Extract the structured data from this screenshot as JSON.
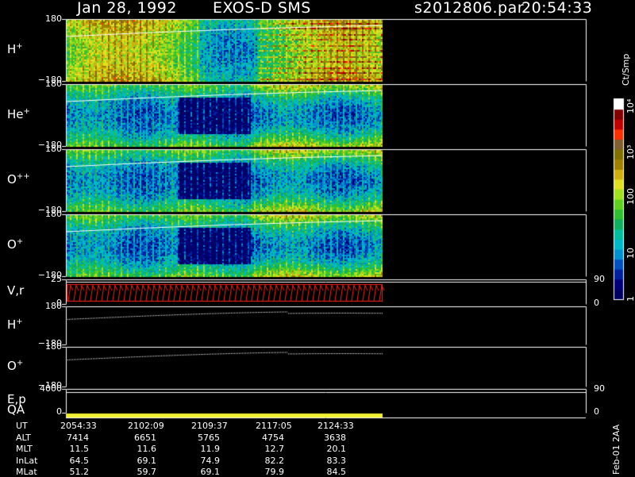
{
  "header": {
    "date": "Jan 28, 1992",
    "mission": "EXOS-D SMS",
    "file": "s2012806.par",
    "time": "20:54:33"
  },
  "chart_data": {
    "type": "heatmap",
    "panels": [
      {
        "label": "H",
        "sup": "+",
        "ymax": "180",
        "ymin": "−180",
        "kind": "spectrogram",
        "palette": "bright"
      },
      {
        "label": "He",
        "sup": "+",
        "ymax": "180",
        "ymin": "−180",
        "kind": "spectrogram",
        "palette": "mid"
      },
      {
        "label": "O",
        "sup": "++",
        "ymax": "180",
        "ymin": "−180",
        "kind": "spectrogram",
        "palette": "mid"
      },
      {
        "label": "O",
        "sup": "+",
        "ymax": "180",
        "ymin": "−180",
        "kind": "spectrogram",
        "palette": "mid"
      },
      {
        "label": "V,r",
        "sup": "",
        "ymax": "25",
        "ymin": "0",
        "right_max": "90",
        "right_min": "0",
        "kind": "vr"
      },
      {
        "label": "H",
        "sup": "+",
        "ymax": "180",
        "ymin": "−180",
        "kind": "line"
      },
      {
        "label": "O",
        "sup": "+",
        "ymax": "180",
        "ymin": "−180",
        "kind": "line"
      },
      {
        "label": "E,p",
        "sup": "",
        "ymax": "4000",
        "ymin": "0",
        "right_max": "90",
        "right_min": "0",
        "kind": "ep"
      }
    ],
    "qa_label": "QA",
    "qa_color": "#f0f030",
    "colorbar": {
      "unit": "Ct/Smp",
      "ticks": [
        "1",
        "10",
        "100",
        "10³",
        "10⁴"
      ],
      "colors": [
        "#000060",
        "#00007a",
        "#0020a0",
        "#0050c0",
        "#0090d0",
        "#00b8c8",
        "#00c0a0",
        "#10b060",
        "#30c030",
        "#60d020",
        "#a0e020",
        "#e0e020",
        "#d0b010",
        "#a08000",
        "#807000",
        "#806030",
        "#ff3000",
        "#c00000",
        "#800000",
        "#ffffff"
      ]
    },
    "footer": {
      "rows": [
        {
          "label": "UT",
          "values": [
            "2054:33",
            "2102:09",
            "2109:37",
            "2117:05",
            "2124:33"
          ]
        },
        {
          "label": "ALT",
          "values": [
            "7414",
            "6651",
            "5765",
            "4754",
            "3638"
          ]
        },
        {
          "label": "MLT",
          "values": [
            "11.5",
            "11.6",
            "11.9",
            "12.7",
            "20.1"
          ]
        },
        {
          "label": "InLat",
          "values": [
            "64.5",
            "69.1",
            "74.9",
            "82.2",
            "83.3"
          ]
        },
        {
          "label": "MLat",
          "values": [
            "51.2",
            "59.7",
            "69.1",
            "79.9",
            "84.5"
          ]
        }
      ]
    },
    "stamp": "Feb-01 2AA"
  }
}
